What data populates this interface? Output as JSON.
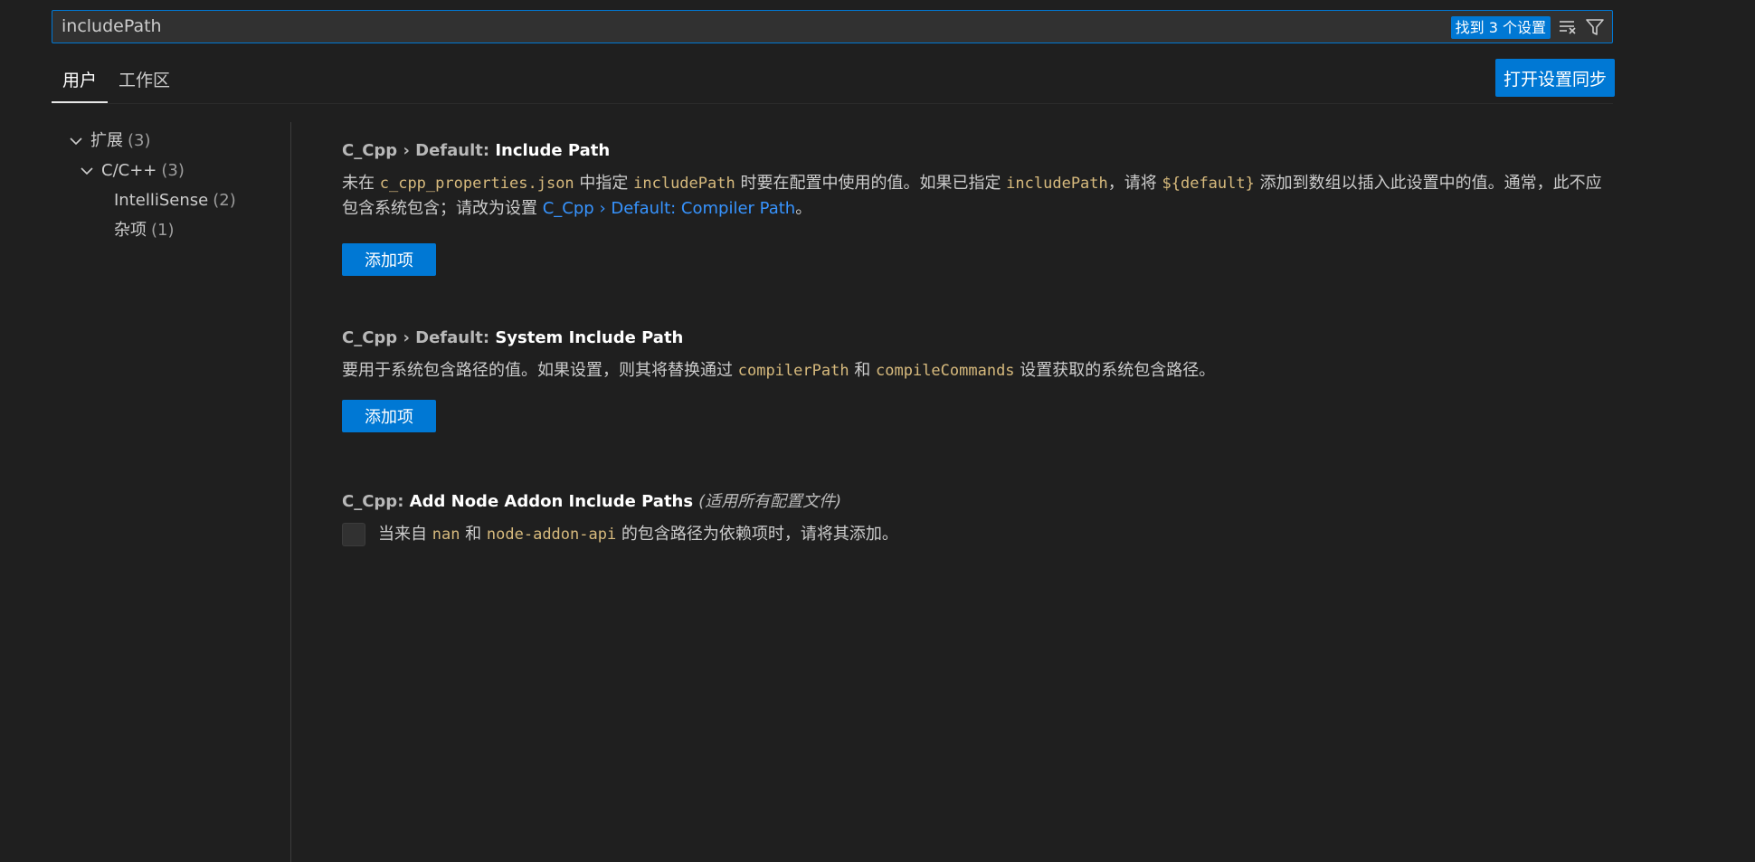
{
  "search": {
    "value": "includePath",
    "found_label": "找到 3 个设置",
    "clear_icon": "clear-filter-icon",
    "filter_icon": "filter-icon"
  },
  "tabs": [
    {
      "label": "用户",
      "active": true
    },
    {
      "label": "工作区",
      "active": false
    }
  ],
  "sync_button": "打开设置同步",
  "toc": [
    {
      "label": "扩展",
      "count": "(3)",
      "expanded": true
    },
    {
      "label": "C/C++",
      "count": "(3)",
      "expanded": true
    },
    {
      "label": "IntelliSense",
      "count": "(2)"
    },
    {
      "label": "杂项",
      "count": "(1)"
    }
  ],
  "settings": [
    {
      "prefix": "C_Cpp › Default: ",
      "name": "Include Path",
      "desc": {
        "t1": "未在 ",
        "c1": "c_cpp_properties.json",
        "t2": " 中指定 ",
        "c2": "includePath",
        "t3": " 时要在配置中使用的值。如果已指定 ",
        "c3": "includePath",
        "t4": "，请将 ",
        "c4": "${default}",
        "t5": " 添加到数组以插入此设置中的值。通常，此不应包含系统包含；请改为设置 ",
        "link": "C_Cpp › Default: Compiler Path",
        "t6": "。"
      },
      "button": "添加项"
    },
    {
      "prefix": "C_Cpp › Default: ",
      "name": "System Include Path",
      "desc": {
        "t1": "要用于系统包含路径的值。如果设置，则其将替换通过 ",
        "c1": "compilerPath",
        "t2": " 和 ",
        "c2": "compileCommands",
        "t3": " 设置获取的系统包含路径。"
      },
      "button": "添加项"
    },
    {
      "prefix": "C_Cpp: ",
      "name": "Add Node Addon Include Paths",
      "scope": "(适用所有配置文件)",
      "desc": {
        "t1": "当来自 ",
        "c1": "nan",
        "t2": " 和 ",
        "c2": "node-addon-api",
        "t3": " 的包含路径为依赖项时，请将其添加。"
      },
      "checked": false
    }
  ],
  "colors": {
    "background": "#1f1f1f",
    "accent": "#0078d4",
    "code": "#d7ba7d",
    "link": "#3794ff"
  }
}
